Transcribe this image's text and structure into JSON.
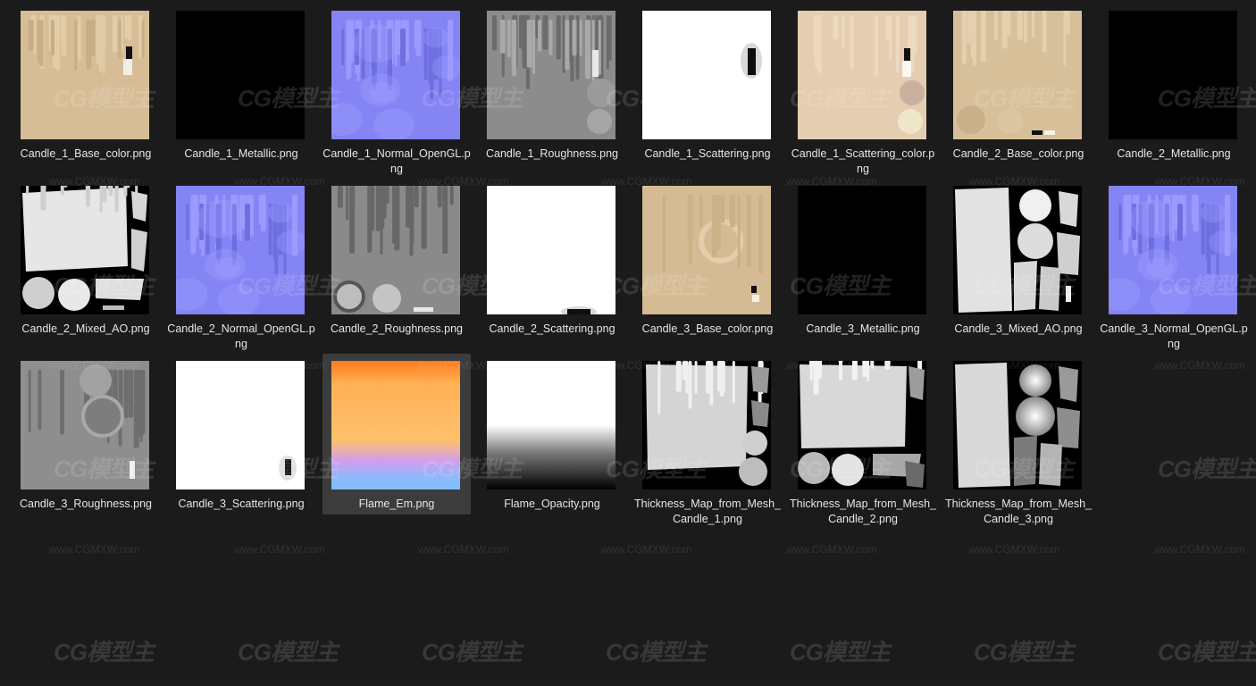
{
  "files": [
    {
      "name": "Candle_1_Base_color.png",
      "kind": "base1"
    },
    {
      "name": "Candle_1_Metallic.png",
      "kind": "black"
    },
    {
      "name": "Candle_1_Normal_OpenGL.png",
      "kind": "normal"
    },
    {
      "name": "Candle_1_Roughness.png",
      "kind": "rough1"
    },
    {
      "name": "Candle_1_Scattering.png",
      "kind": "scatter1"
    },
    {
      "name": "Candle_1_Scattering_color.png",
      "kind": "scattercolor"
    },
    {
      "name": "Candle_2_Base_color.png",
      "kind": "base2"
    },
    {
      "name": "Candle_2_Metallic.png",
      "kind": "black"
    },
    {
      "name": "Candle_2_Mixed_AO.png",
      "kind": "ao2"
    },
    {
      "name": "Candle_2_Normal_OpenGL.png",
      "kind": "normal"
    },
    {
      "name": "Candle_2_Roughness.png",
      "kind": "rough2"
    },
    {
      "name": "Candle_2_Scattering.png",
      "kind": "scatter2"
    },
    {
      "name": "Candle_3_Base_color.png",
      "kind": "base3"
    },
    {
      "name": "Candle_3_Metallic.png",
      "kind": "black"
    },
    {
      "name": "Candle_3_Mixed_AO.png",
      "kind": "ao3"
    },
    {
      "name": "Candle_3_Normal_OpenGL.png",
      "kind": "normal"
    },
    {
      "name": "Candle_3_Roughness.png",
      "kind": "rough3"
    },
    {
      "name": "Candle_3_Scattering.png",
      "kind": "scatter3"
    },
    {
      "name": "Flame_Em.png",
      "kind": "flame",
      "selected": true
    },
    {
      "name": "Flame_Opacity.png",
      "kind": "opacity"
    },
    {
      "name": "Thickness_Map_from_Mesh_Candle_1.png",
      "kind": "thick1"
    },
    {
      "name": "Thickness_Map_from_Mesh_Candle_2.png",
      "kind": "thick2"
    },
    {
      "name": "Thickness_Map_from_Mesh_Candle_3.png",
      "kind": "thick3"
    }
  ],
  "watermark": {
    "logo": "CG模型主",
    "url": "www.CGMXW.com"
  },
  "colors": {
    "background": "#1b1b1b",
    "selected": "#3c3c3c",
    "text": "#e6e6e6",
    "wax": "#d8bf98",
    "normal": "#8080f6"
  }
}
